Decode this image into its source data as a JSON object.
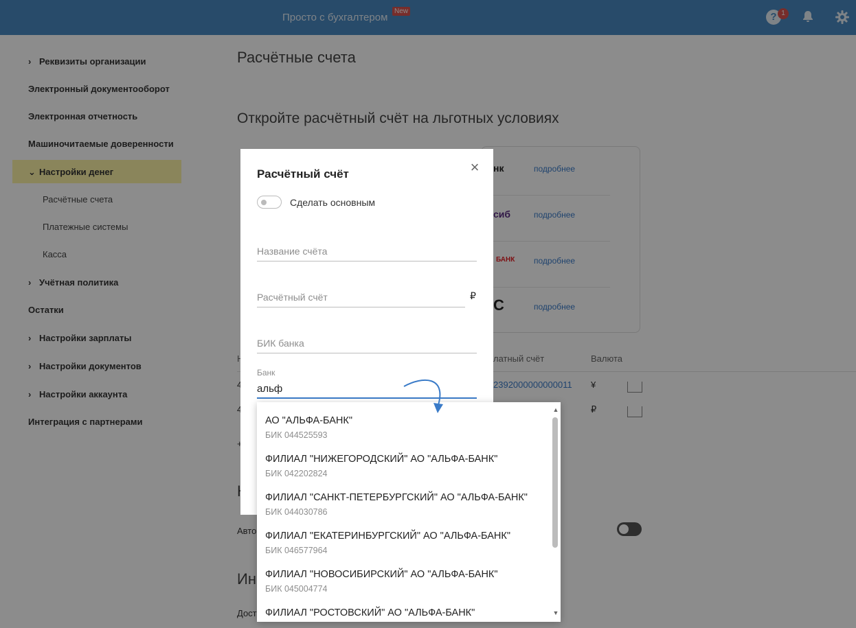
{
  "topbar": {
    "title": "Просто с бухгалтером",
    "new_badge": "New",
    "help_icon": "question-icon",
    "help_count": "1",
    "bell_icon": "bell-icon",
    "gear_icon": "gear-icon",
    "accent": "#4a89c2"
  },
  "sidebar": {
    "items": [
      {
        "label": "Реквизиты организации",
        "chevron": "›"
      },
      {
        "label": "Электронный документооборот"
      },
      {
        "label": "Электронная отчетность"
      },
      {
        "label": "Машиночитаемые доверенности"
      },
      {
        "label": "Настройки денег",
        "chevron": "⌄",
        "active": true
      },
      {
        "label": "Учётная политика",
        "chevron": "›"
      },
      {
        "label": "Остатки"
      },
      {
        "label": "Настройки зарплаты",
        "chevron": "›"
      },
      {
        "label": "Настройки документов",
        "chevron": "›"
      },
      {
        "label": "Настройки аккаунта",
        "chevron": "›"
      },
      {
        "label": "Интеграция с партнерами"
      }
    ],
    "subitems": [
      {
        "label": "Расчётные счета"
      },
      {
        "label": "Платежные системы"
      },
      {
        "label": "Касса"
      }
    ]
  },
  "main": {
    "title": "Расчётные счета",
    "promo_title": "Откройте расчётный счёт на льготных условиях",
    "promo_banks": [
      {
        "name": "нк",
        "more": "подробнее"
      },
      {
        "name": "сиб",
        "more": "подробнее"
      },
      {
        "name": "БАНК",
        "more": "подробнее"
      },
      {
        "name": "C",
        "more": "подробнее"
      }
    ],
    "table": {
      "headers": [
        "Н",
        "латный счёт",
        "Валюта"
      ],
      "rows": [
        {
          "left": "4",
          "account": "2392000000000011",
          "currency": "¥"
        },
        {
          "left": "4",
          "account": "",
          "currency": "₽"
        }
      ]
    },
    "fragments": {
      "plus": "+",
      "section_letter": "Н",
      "auto_label": "Авто",
      "section_letters2": "Ин",
      "dost_label": "Дост"
    }
  },
  "modal": {
    "title": "Расчётный счёт",
    "close_icon": "close-icon",
    "switch_label": "Сделать основным",
    "account_name_placeholder": "Название счёта",
    "account_number_placeholder": "Расчётный счёт",
    "currency_symbol": "₽",
    "bik_placeholder": "БИК банка",
    "bank_label": "Банк",
    "bank_value": "альф"
  },
  "dropdown": {
    "items": [
      {
        "name": "АО \"АЛЬФА-БАНК\"",
        "bik": "БИК 044525593"
      },
      {
        "name": "ФИЛИАЛ \"НИЖЕГОРОДСКИЙ\" АО \"АЛЬФА-БАНК\"",
        "bik": "БИК 042202824"
      },
      {
        "name": "ФИЛИАЛ \"САНКТ-ПЕТЕРБУРГСКИЙ\" АО \"АЛЬФА-БАНК\"",
        "bik": "БИК 044030786"
      },
      {
        "name": "ФИЛИАЛ \"ЕКАТЕРИНБУРГСКИЙ\" АО \"АЛЬФА-БАНК\"",
        "bik": "БИК 046577964"
      },
      {
        "name": "ФИЛИАЛ \"НОВОСИБИРСКИЙ\" АО \"АЛЬФА-БАНК\"",
        "bik": "БИК 045004774"
      },
      {
        "name": "ФИЛИАЛ \"РОСТОВСКИЙ\" АО \"АЛЬФА-БАНК\"",
        "bik": ""
      }
    ],
    "scroll_up_icon": "arrow-up-icon",
    "scroll_down_icon": "arrow-down-icon"
  },
  "annotation": {
    "arrow_icon": "curved-arrow-icon",
    "arrow_color": "#3a7bc8"
  }
}
